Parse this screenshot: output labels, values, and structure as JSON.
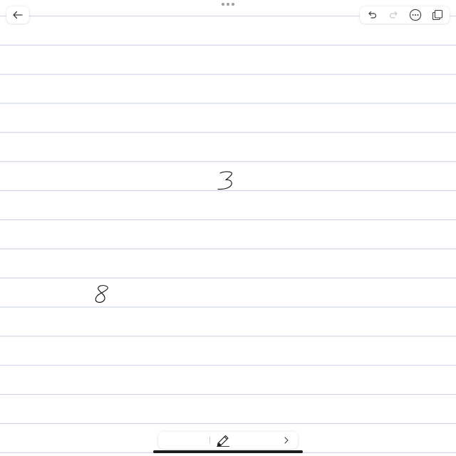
{
  "canvas": {
    "line_color": "#c9d1e3",
    "background": "#ffffff",
    "handwritten": [
      "3",
      "8"
    ]
  },
  "toolbar": {
    "back_icon": "arrow-left-icon",
    "undo_icon": "undo-icon",
    "redo_icon": "redo-icon",
    "more_icon": "ellipsis-circle-icon",
    "pages_icon": "copy-pages-icon"
  },
  "bottom_toolbar": {
    "tool_icon": "pencil-icon",
    "expand_icon": "chevron-right-icon"
  }
}
